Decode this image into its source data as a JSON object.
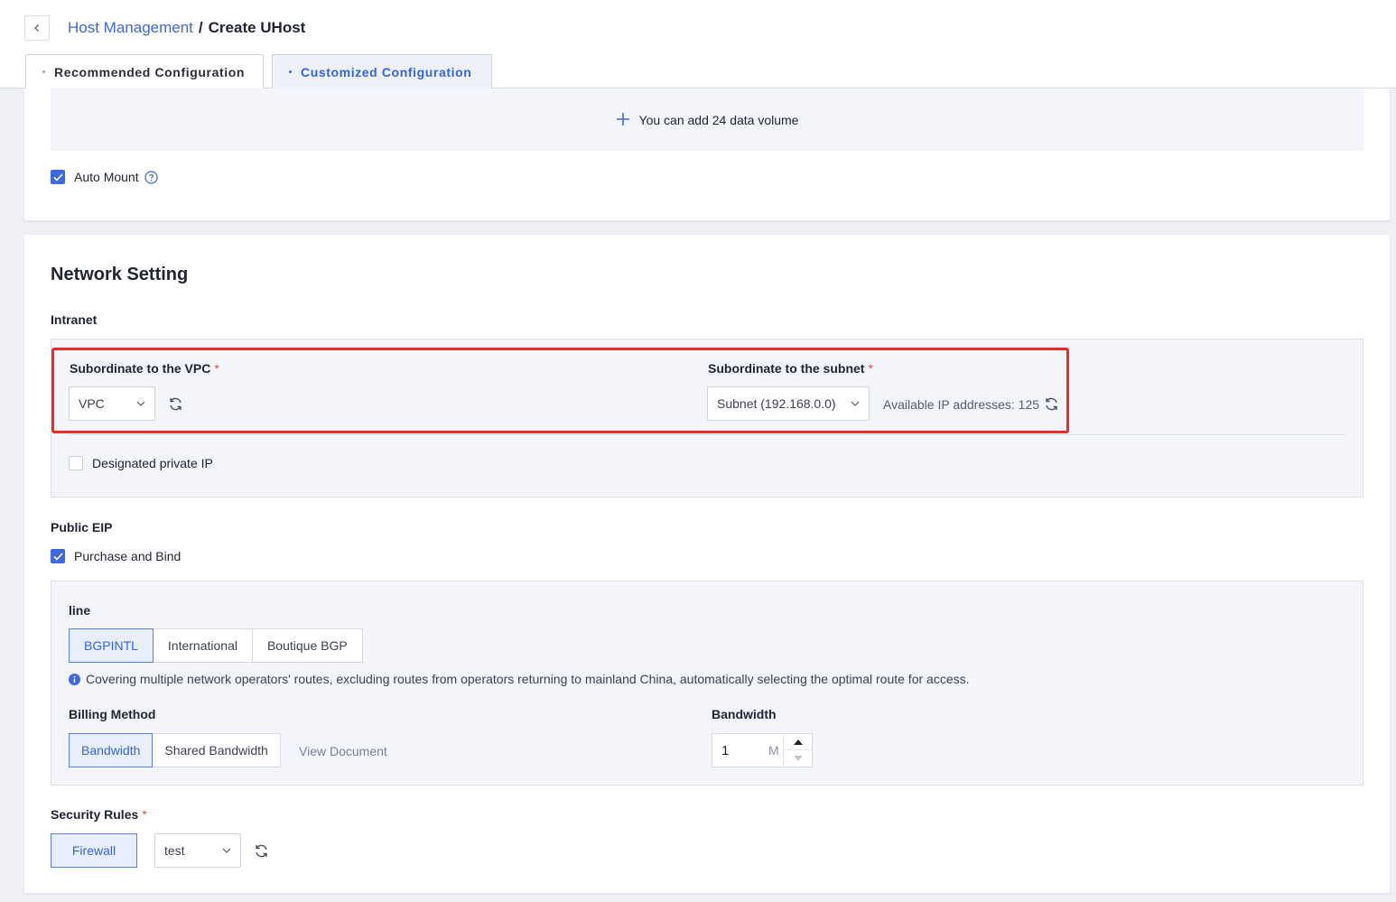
{
  "breadcrumb": {
    "parent": "Host Management",
    "separator": "/",
    "current": "Create UHost"
  },
  "tabs": [
    {
      "label": "Recommended Configuration",
      "active": false
    },
    {
      "label": "Customized Configuration",
      "active": true
    }
  ],
  "storage": {
    "add_volume_label": "You can add 24 data volume",
    "auto_mount_label": "Auto Mount",
    "auto_mount_checked": true
  },
  "network": {
    "title": "Network Setting",
    "intranet": {
      "title": "Intranet",
      "vpc_label": "Subordinate to the VPC",
      "vpc_value": "VPC",
      "subnet_label": "Subordinate to the subnet",
      "subnet_value": "Subnet (192.168.0.0)",
      "available_ip": "Available IP addresses: 125",
      "designated_ip_label": "Designated private IP",
      "designated_ip_checked": false
    },
    "eip": {
      "title": "Public EIP",
      "purchase_label": "Purchase and Bind",
      "purchase_checked": true,
      "line_label": "line",
      "lines": [
        "BGPINTL",
        "International",
        "Boutique BGP"
      ],
      "active_line": "BGPINTL",
      "line_info": "Covering multiple network operators' routes, excluding routes from operators returning to mainland China, automatically selecting the optimal route for access.",
      "billing_label": "Billing Method",
      "billing_options": [
        "Bandwidth",
        "Shared Bandwidth"
      ],
      "active_billing": "Bandwidth",
      "view_document": "View Document",
      "bandwidth_label": "Bandwidth",
      "bandwidth_value": "1",
      "bandwidth_unit": "M"
    },
    "security": {
      "label": "Security Rules",
      "firewall_label": "Firewall",
      "firewall_value": "test"
    }
  },
  "colors": {
    "accent": "#3563e0",
    "highlight": "#f02a2a",
    "required": "#e5484d"
  }
}
